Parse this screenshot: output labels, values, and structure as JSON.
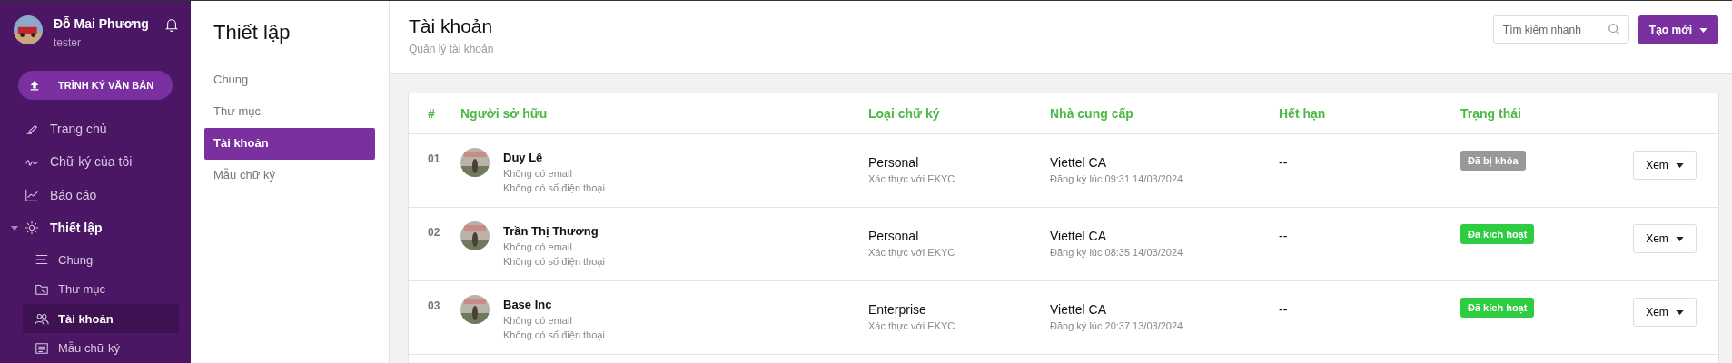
{
  "user": {
    "name": "Đỗ Mai Phương",
    "role": "tester"
  },
  "primary_action": {
    "label": "TRÌNH KÝ VĂN BẢN"
  },
  "nav": [
    {
      "label": "Trang chủ",
      "selected": false
    },
    {
      "label": "Chữ ký của tôi",
      "selected": false
    },
    {
      "label": "Báo cáo",
      "selected": false
    },
    {
      "label": "Thiết lập",
      "selected": false,
      "expanded": true,
      "children": [
        {
          "label": "Chung",
          "selected": false
        },
        {
          "label": "Thư mục",
          "selected": false
        },
        {
          "label": "Tài khoản",
          "selected": true
        },
        {
          "label": "Mẫu chữ ký",
          "selected": false
        }
      ]
    }
  ],
  "settings_panel": {
    "title": "Thiết lập",
    "items": [
      {
        "label": "Chung",
        "selected": false
      },
      {
        "label": "Thư mục",
        "selected": false
      },
      {
        "label": "Tài khoản",
        "selected": true
      },
      {
        "label": "Mẫu chữ ký",
        "selected": false
      }
    ]
  },
  "page": {
    "title": "Tài khoản",
    "subtitle": "Quản lý tài khoản",
    "search": {
      "placeholder": "Tìm kiếm nhanh"
    },
    "create_button": "Tạo mới"
  },
  "table": {
    "columns": [
      "#",
      "Người sở hữu",
      "Loại chữ ký",
      "Nhà cung cấp",
      "Hết hạn",
      "Trạng thái"
    ],
    "rows": [
      {
        "index": "01",
        "name": "Duy Lê",
        "email": "Không có email",
        "phone": "Không có số điện thoại",
        "type": "Personal",
        "verification": "Xác thực với EKYC",
        "provider": "Viettel CA",
        "registered": "Đăng ký lúc 09:31 14/03/2024",
        "expires": "--",
        "status": {
          "label": "Đã bị khóa",
          "color": "#999999"
        },
        "action": "Xem"
      },
      {
        "index": "02",
        "name": "Trần Thị Thương",
        "email": "Không có email",
        "phone": "Không có số điện thoại",
        "type": "Personal",
        "verification": "Xác thực với EKYC",
        "provider": "Viettel CA",
        "registered": "Đăng ký lúc 08:35 14/03/2024",
        "expires": "--",
        "status": {
          "label": "Đã kích hoạt",
          "color": "#2ecc40"
        },
        "action": "Xem"
      },
      {
        "index": "03",
        "name": "Base Inc",
        "email": "Không có email",
        "phone": "Không có số điện thoại",
        "type": "Enterprise",
        "verification": "Xác thực với EKYC",
        "provider": "Viettel CA",
        "registered": "Đăng ký lúc 20:37 13/03/2024",
        "expires": "--",
        "status": {
          "label": "Đã kích hoạt",
          "color": "#2ecc40"
        },
        "action": "Xem"
      }
    ]
  }
}
